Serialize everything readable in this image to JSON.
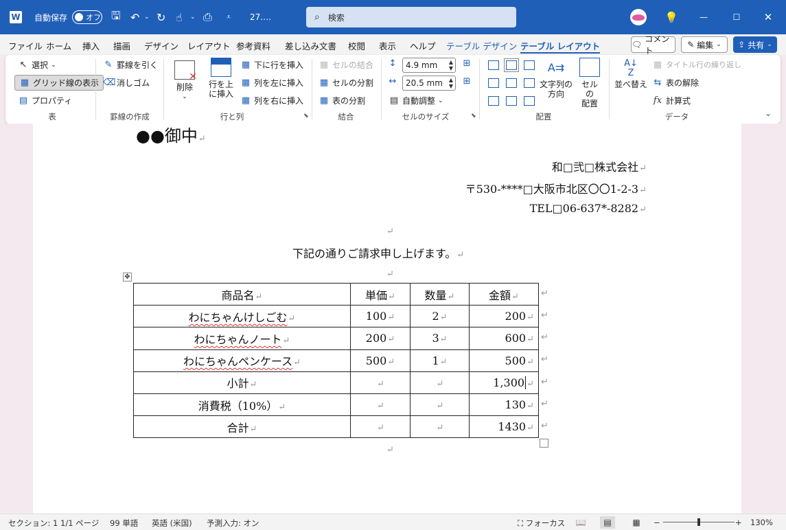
{
  "titlebar": {
    "autosave_label": "自動保存",
    "autosave_state": "オフ",
    "doc_name": "27.…",
    "search_placeholder": "検索"
  },
  "tabs": [
    "ファイル",
    "ホーム",
    "挿入",
    "描画",
    "デザイン",
    "レイアウト",
    "参考資料",
    "差し込み文書",
    "校閲",
    "表示",
    "ヘルプ",
    "テーブル デザイン",
    "テーブル レイアウト"
  ],
  "menu_right": {
    "comment": "コメント",
    "edit": "編集",
    "share": "共有"
  },
  "ribbon": {
    "table": {
      "select": "選択",
      "gridlines": "グリッド線の表示",
      "properties": "プロパティ",
      "label": "表"
    },
    "draw": {
      "draw_borders": "罫線を引く",
      "eraser": "消しゴム",
      "label": "罫線の作成"
    },
    "rows_cols": {
      "delete": "削除",
      "insert_above_1": "行を上",
      "insert_above_2": "に挿入",
      "insert_below": "下に行を挿入",
      "insert_left": "列を左に挿入",
      "insert_right": "列を右に挿入",
      "label": "行と列"
    },
    "merge": {
      "merge_cells": "セルの結合",
      "split_cells": "セルの分割",
      "split_table": "表の分割",
      "label": "結合"
    },
    "cell_size": {
      "height": "4.9 mm",
      "width": "20.5 mm",
      "autofit": "自動調整",
      "label": "セルのサイズ"
    },
    "alignment": {
      "text_dir_1": "文字列の",
      "text_dir_2": "方向",
      "margins_1": "セルの",
      "margins_2": "配置",
      "label": "配置"
    },
    "data": {
      "sort_1": "並べ替え",
      "repeat_header": "タイトル行の繰り返し",
      "convert": "表の解除",
      "formula": "計算式",
      "label": "データ"
    }
  },
  "document": {
    "heading": "●●御中",
    "company": "和□弐□株式会社",
    "address": "〒530-****□大阪市北区〇〇1-2-3",
    "tel": "TEL□06-637*-8282",
    "intro": "下記の通りご請求申し上げます。",
    "table": {
      "header": [
        "商品名",
        "単価",
        "数量",
        "金額"
      ],
      "rows": [
        [
          "わにちゃんけしごむ",
          "100",
          "2",
          "200"
        ],
        [
          "わにちゃんノート",
          "200",
          "3",
          "600"
        ],
        [
          "わにちゃんペンケース",
          "500",
          "1",
          "500"
        ],
        [
          "小計",
          "",
          "",
          "1,300"
        ],
        [
          "消費税（10%）",
          "",
          "",
          "130"
        ],
        [
          "合計",
          "",
          "",
          "1430"
        ]
      ]
    }
  },
  "statusbar": {
    "section": "セクション: 1",
    "page": "1/1 ページ",
    "words": "99 単語",
    "language": "英語 (米国)",
    "predictive": "予測入力: オン",
    "focus": "フォーカス",
    "zoom": "130%"
  },
  "colors": {
    "accent": "#1f5fb8"
  }
}
